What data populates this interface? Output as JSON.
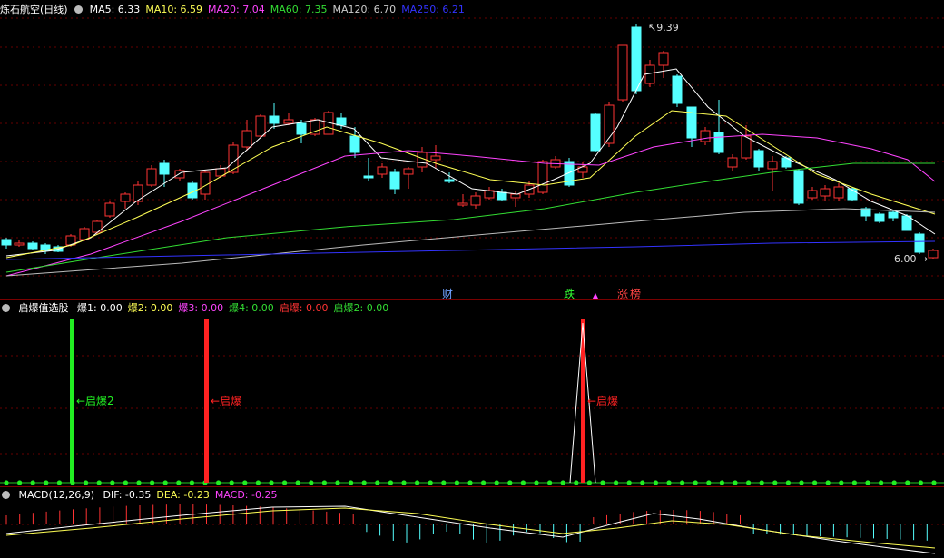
{
  "main_chart": {
    "title": "炼石航空(日线)",
    "ma_legend": [
      {
        "label": "MA5: 6.33",
        "color": "#ffffff"
      },
      {
        "label": "MA10: 6.59",
        "color": "#ffff55"
      },
      {
        "label": "MA20: 7.04",
        "color": "#ff44ff"
      },
      {
        "label": "MA60: 7.35",
        "color": "#33dd33"
      },
      {
        "label": "MA120: 6.70",
        "color": "#cccccc"
      },
      {
        "label": "MA250: 6.21",
        "color": "#3333ff"
      }
    ],
    "high_label": "9.39",
    "low_label": "6.00",
    "markers": [
      {
        "text": "财",
        "color": "#6fa0ff"
      },
      {
        "text": "跌",
        "color": "#33ff33"
      },
      {
        "text": "▲",
        "color": "#ff44ff"
      },
      {
        "text": "涨",
        "color": "#ff4444"
      },
      {
        "text": "榜",
        "color": "#ff4444"
      }
    ],
    "colors": {
      "up": "#ff3333",
      "down": "#55ffff",
      "grid": "#660000"
    }
  },
  "indicator": {
    "title": "启爆值选股",
    "values": [
      {
        "label": "爆1: 0.00",
        "color": "#ffffff"
      },
      {
        "label": "爆2: 0.00",
        "color": "#ffff55"
      },
      {
        "label": "爆3: 0.00",
        "color": "#ff44ff"
      },
      {
        "label": "爆4: 0.00",
        "color": "#33dd33"
      },
      {
        "label": "启爆: 0.00",
        "color": "#ff3333"
      },
      {
        "label": "启爆2: 0.00",
        "color": "#33dd33"
      }
    ],
    "signals": [
      {
        "label": "←启爆2",
        "color": "#22ee22"
      },
      {
        "label": "←启爆",
        "color": "#ff2222"
      },
      {
        "label": "←启爆",
        "color": "#ff2222"
      }
    ]
  },
  "macd": {
    "title": "MACD(12,26,9)",
    "values": [
      {
        "label": "DIF: -0.35",
        "color": "#ffffff"
      },
      {
        "label": "DEA: -0.23",
        "color": "#ffff55"
      },
      {
        "label": "MACD: -0.25",
        "color": "#ff44ff"
      }
    ]
  }
}
